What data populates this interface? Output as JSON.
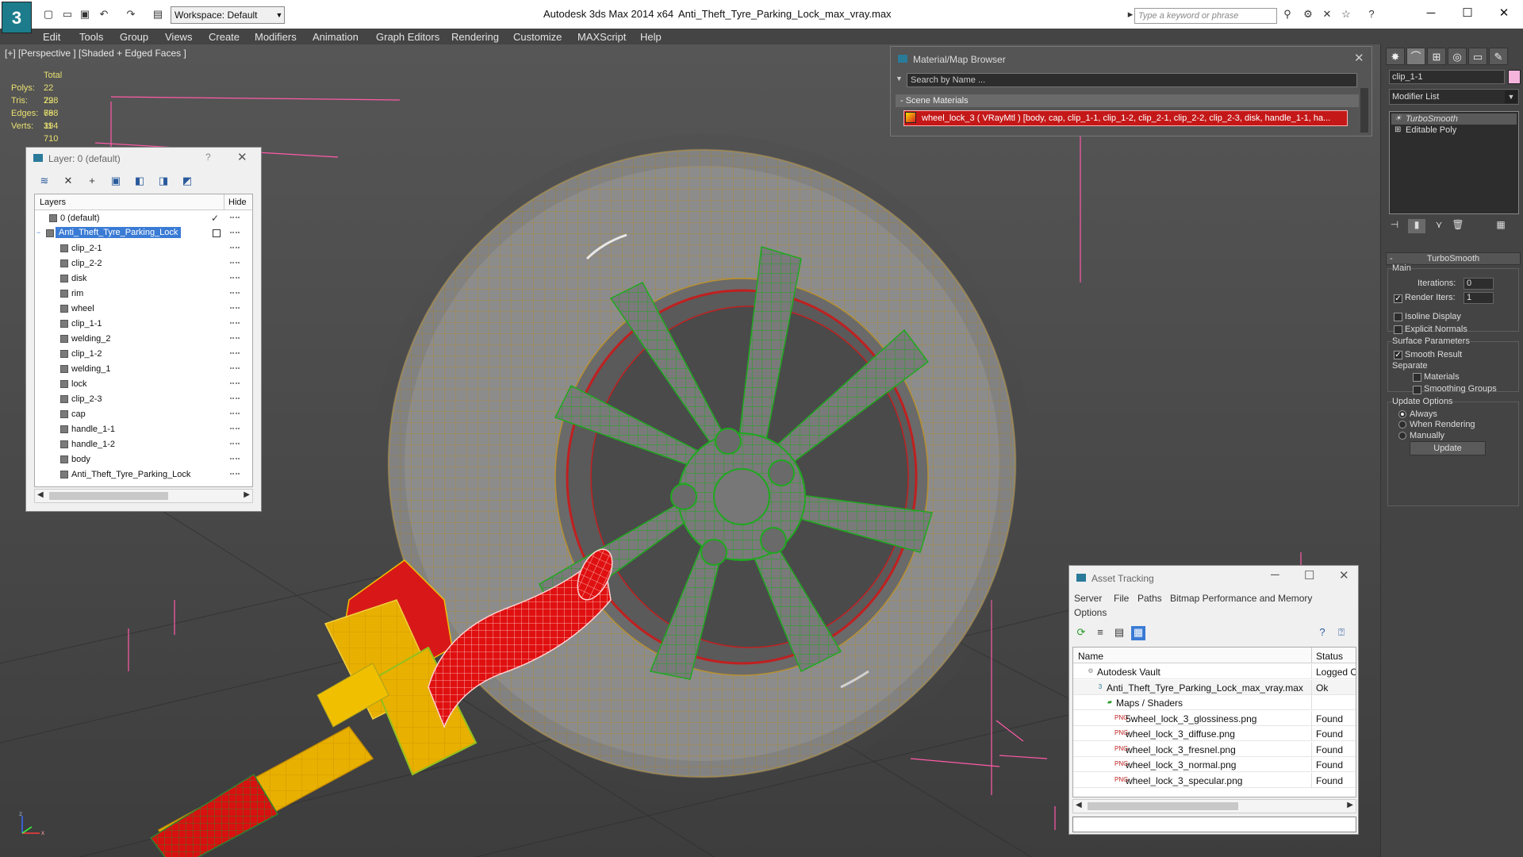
{
  "titlebar": {
    "workspace": "Workspace: Default",
    "app_title": "Autodesk 3ds Max  2014 x64",
    "file_title": "Anti_Theft_Tyre_Parking_Lock_max_vray.max",
    "search_placeholder": "Type a keyword or phrase"
  },
  "menu": [
    "Edit",
    "Tools",
    "Group",
    "Views",
    "Create",
    "Modifiers",
    "Animation",
    "Graph Editors",
    "Rendering",
    "Customize",
    "MAXScript",
    "Help"
  ],
  "viewport": {
    "label": "[+] [Perspective ] [Shaded + Edged Faces ]",
    "stats": {
      "total_label": "Total",
      "rows": [
        {
          "label": "Polys:",
          "value": "22 798"
        },
        {
          "label": "Tris:",
          "value": "22 798"
        },
        {
          "label": "Edges:",
          "value": "68 394"
        },
        {
          "label": "Verts:",
          "value": "11 710"
        }
      ]
    }
  },
  "layer_panel": {
    "title": "Layer: 0 (default)",
    "help": "?",
    "col_layers": "Layers",
    "col_hide": "Hide",
    "rows": [
      {
        "name": "0 (default)",
        "level": 1,
        "check": "✓"
      },
      {
        "name": "Anti_Theft_Tyre_Parking_Lock",
        "level": 0,
        "selected": true
      },
      {
        "name": "clip_2-1",
        "level": 2
      },
      {
        "name": "clip_2-2",
        "level": 2
      },
      {
        "name": "disk",
        "level": 2
      },
      {
        "name": "rim",
        "level": 2
      },
      {
        "name": "wheel",
        "level": 2
      },
      {
        "name": "clip_1-1",
        "level": 2
      },
      {
        "name": "welding_2",
        "level": 2
      },
      {
        "name": "clip_1-2",
        "level": 2
      },
      {
        "name": "welding_1",
        "level": 2
      },
      {
        "name": "lock",
        "level": 2
      },
      {
        "name": "clip_2-3",
        "level": 2
      },
      {
        "name": "cap",
        "level": 2
      },
      {
        "name": "handle_1-1",
        "level": 2
      },
      {
        "name": "handle_1-2",
        "level": 2
      },
      {
        "name": "body",
        "level": 2
      },
      {
        "name": "Anti_Theft_Tyre_Parking_Lock",
        "level": 2
      }
    ]
  },
  "material_browser": {
    "title": "Material/Map Browser",
    "search": "Search by Name ...",
    "section": "- Scene Materials",
    "material": "wheel_lock_3  ( VRayMtl ) [body, cap, clip_1-1, clip_1-2, clip_2-1, clip_2-2, clip_2-3, disk, handle_1-1, ha..."
  },
  "command_panel": {
    "object_name": "clip_1-1",
    "modifier_list": "Modifier List",
    "stack": [
      "TurboSmooth",
      "Editable Poly"
    ],
    "rollout_title": "TurboSmooth",
    "main_label": "Main",
    "iterations_label": "Iterations:",
    "iterations_value": "0",
    "render_iters_label": "Render Iters:",
    "render_iters_value": "1",
    "isoline": "Isoline Display",
    "explicit_normals": "Explicit Normals",
    "surface_params": "Surface Parameters",
    "smooth_result": "Smooth Result",
    "separate": "Separate",
    "materials": "Materials",
    "smoothing_groups": "Smoothing Groups",
    "update_options": "Update Options",
    "always": "Always",
    "when_rendering": "When Rendering",
    "manually": "Manually",
    "update_btn": "Update"
  },
  "asset_tracking": {
    "title": "Asset Tracking",
    "menu": [
      "Server",
      "File",
      "Paths",
      "Bitmap Performance and Memory",
      "Options"
    ],
    "col_name": "Name",
    "col_status": "Status",
    "rows": [
      {
        "name": "Autodesk Vault",
        "status": "Logged O",
        "indent": 1,
        "icon": "vault"
      },
      {
        "name": "Anti_Theft_Tyre_Parking_Lock_max_vray.max",
        "status": "Ok",
        "indent": 2,
        "icon": "max"
      },
      {
        "name": "Maps / Shaders",
        "status": "",
        "indent": 3,
        "icon": "maps"
      },
      {
        "name": "5wheel_lock_3_glossiness.png",
        "status": "Found",
        "indent": 4,
        "icon": "png"
      },
      {
        "name": "wheel_lock_3_diffuse.png",
        "status": "Found",
        "indent": 4,
        "icon": "png"
      },
      {
        "name": "wheel_lock_3_fresnel.png",
        "status": "Found",
        "indent": 4,
        "icon": "png"
      },
      {
        "name": "wheel_lock_3_normal.png",
        "status": "Found",
        "indent": 4,
        "icon": "png"
      },
      {
        "name": "wheel_lock_3_specular.png",
        "status": "Found",
        "indent": 4,
        "icon": "png"
      }
    ]
  },
  "gizmo": {
    "x": "x",
    "z": "z"
  },
  "colors": {
    "viewport_bg": "#4d4d4d",
    "selection_blue": "#3a7bd5",
    "material_red": "#c41818",
    "stats_yellow": "#e8e070",
    "tire_gray": "#8e8e8e",
    "rim_green": "#2ea82e",
    "lock_red": "#d81818",
    "lock_yellow": "#e8b400"
  }
}
